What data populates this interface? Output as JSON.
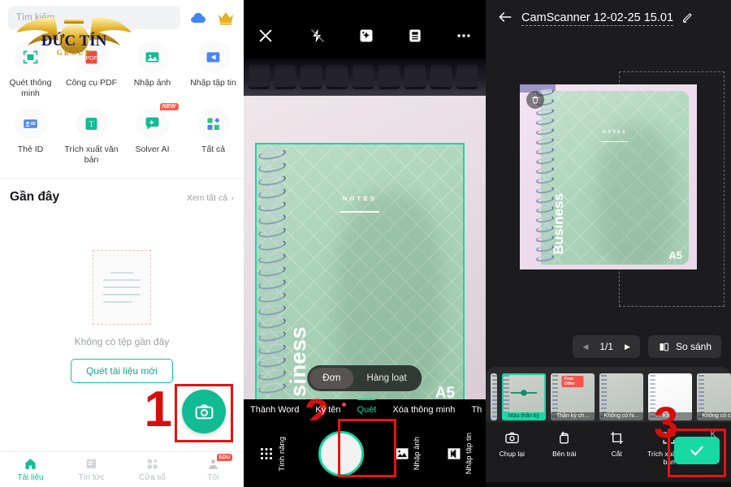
{
  "panels": {
    "home": {
      "search": {
        "placeholder": "Tìm kiếm"
      },
      "header_icons": {
        "cloud": "cloud-icon",
        "crown": "crown-icon"
      },
      "watermark": {
        "line1": "ĐỨC TÍN",
        "line2": "GROUP"
      },
      "tools": [
        {
          "label": "Quét thông minh",
          "icon": "smart-scan-icon"
        },
        {
          "label": "Công cụ PDF",
          "icon": "pdf-tool-icon"
        },
        {
          "label": "Nhập ảnh",
          "icon": "import-image-icon"
        },
        {
          "label": "Nhập tập tin",
          "icon": "import-file-icon"
        },
        {
          "label": "Thẻ ID",
          "icon": "id-card-icon"
        },
        {
          "label": "Trích xuất văn bản",
          "icon": "extract-text-icon"
        },
        {
          "label": "Solver AI",
          "icon": "solver-ai-icon",
          "badge": "NEW"
        },
        {
          "label": "Tất cả",
          "icon": "all-tools-icon"
        }
      ],
      "recent": {
        "title": "Gần đây",
        "see_all": "Xem tất cả",
        "chevron": "›",
        "empty_text": "Không có tệp gần đây",
        "scan_button": "Quét tài liệu mới"
      },
      "fab": {
        "icon": "camera-icon"
      },
      "bottom_nav": [
        {
          "label": "Tài liệu",
          "icon": "home-icon",
          "active": true
        },
        {
          "label": "Tín tức",
          "icon": "news-icon",
          "active": false
        },
        {
          "label": "Cửa sổ",
          "icon": "apps-icon",
          "active": false
        },
        {
          "label": "Tôi",
          "icon": "profile-icon",
          "active": false,
          "badge": "EDU"
        }
      ]
    },
    "camera": {
      "top_icons": [
        {
          "name": "close-icon",
          "glyph": "×"
        },
        {
          "name": "flash-off-icon"
        },
        {
          "name": "auto-enhance-icon"
        },
        {
          "name": "id-mode-icon"
        },
        {
          "name": "more-icon",
          "glyph": "•••"
        }
      ],
      "mode_toggle": {
        "options": [
          "Đơn",
          "Hàng loạt"
        ],
        "selected": "Đơn"
      },
      "tabs": [
        {
          "label": "Thành Word",
          "active": false
        },
        {
          "label": "Ký tên",
          "active": false,
          "dot": true
        },
        {
          "label": "Quét",
          "active": true
        },
        {
          "label": "Xóa thông minh",
          "active": false
        },
        {
          "label": "Th",
          "active": false
        }
      ],
      "bottom": {
        "features_label": "Tính năng",
        "import_image_label": "Nhập ảnh",
        "import_file_label": "Nhập tập tin",
        "shutter": "shutter-button"
      },
      "scene": {
        "notes": "NOTES",
        "business": "Business",
        "size": "A5"
      }
    },
    "preview": {
      "back": "back-arrow-icon",
      "title": "CamScanner 12-02-25 15.01",
      "edit_icon": "pencil-icon",
      "doc": {
        "notes": "NOTES",
        "business": "Business",
        "size": "A5"
      },
      "trash_icon": "trash-icon",
      "pager": {
        "prev": "◀",
        "value": "1/1",
        "next": "▶"
      },
      "compare": {
        "label": "So sánh",
        "icon": "compare-icon"
      },
      "filters": [
        {
          "label": "Màu thần kỳ",
          "selected": true
        },
        {
          "label": "Thần kỳ ch...",
          "selected": false,
          "badge": "Free Offer"
        },
        {
          "label": "Không có hi...",
          "selected": false
        },
        {
          "label": "Khô...",
          "selected": false
        },
        {
          "label": "Không có c...",
          "selected": false
        }
      ],
      "actions": [
        {
          "label": "Chụp lại",
          "icon": "retake-icon"
        },
        {
          "label": "Bên trái",
          "icon": "rotate-left-icon"
        },
        {
          "label": "Cắt",
          "icon": "crop-icon"
        },
        {
          "label": "Trích xuất văn bản",
          "icon": "extract-text-icon"
        },
        {
          "label": "K",
          "icon": "more-icon"
        }
      ],
      "done": {
        "icon": "check-icon"
      }
    }
  },
  "annotations": {
    "one": "1",
    "two": "2",
    "three": "3",
    "color": "#d60f0c"
  }
}
